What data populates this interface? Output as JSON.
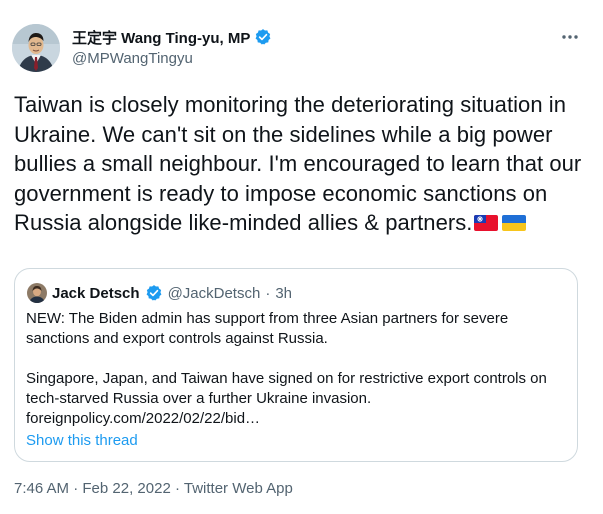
{
  "author": {
    "display_name": "王定宇 Wang Ting-yu, MP",
    "handle": "@MPWangTingyu",
    "verified_icon": "verified-badge-icon",
    "more_icon": "more-options-icon"
  },
  "tweet": {
    "text": "Taiwan is closely monitoring the deteriorating situation in Ukraine. We can't sit on the sidelines while a big power bullies a small neighbour. I'm encouraged to learn that our government is ready to impose economic sanctions on Russia alongside like-minded allies & partners.",
    "flags": [
      "taiwan-flag-icon",
      "ukraine-flag-icon"
    ]
  },
  "quoted": {
    "display_name": "Jack Detsch",
    "handle": "@JackDetsch",
    "separator": "·",
    "time": "3h",
    "paragraph_1": "NEW: The Biden admin has support from three Asian partners for severe sanctions and export controls against Russia.",
    "paragraph_2": "Singapore, Japan, and Taiwan have signed on for restrictive export controls on tech-starved Russia over a further Ukraine invasion.",
    "link": "foreignpolicy.com/2022/02/22/bid…",
    "show_thread": "Show this thread"
  },
  "meta": {
    "time": "7:46 AM",
    "sep1": "·",
    "date": "Feb 22, 2022",
    "sep2": "·",
    "source": "Twitter Web App"
  },
  "colors": {
    "text": "#0f1419",
    "secondary": "#536471",
    "accent": "#1d9bf0",
    "border": "#cfd9de"
  }
}
